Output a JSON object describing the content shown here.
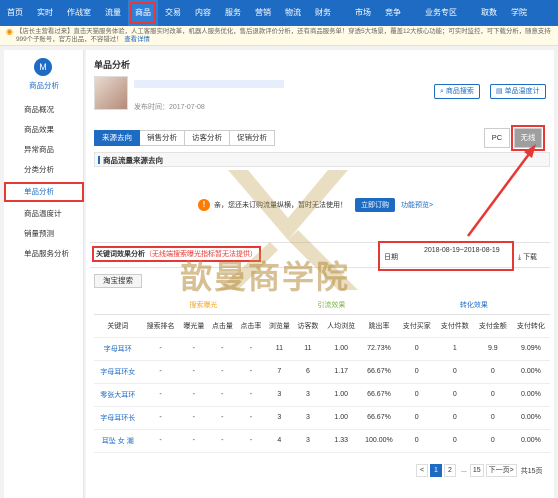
{
  "topnav": {
    "items": [
      "首页",
      "实时",
      "作战室",
      "流量",
      "商品",
      "交易",
      "内容",
      "服务",
      "营销",
      "物流",
      "财务",
      "市场",
      "竞争",
      "业务专区",
      "取数",
      "学院"
    ]
  },
  "notice": {
    "text": "【店长主营看过来】直击天猫服务体验，人工客服实时改革，机器人服务优化，售后退款评价分析，还有商品服务单！穿透5大场景，覆盖12大核心功能；可实时监控，可下载分析，随意支持999个子账号，官方出品，不容错过！",
    "link": "查看详情"
  },
  "sidebar": {
    "title": "商品分析",
    "items": [
      "商品概况",
      "商品效果",
      "异常商品",
      "分类分析",
      "单品分析",
      "商品温度计",
      "销量预测",
      "单品服务分析"
    ]
  },
  "main": {
    "title": "单品分析",
    "publish": "发布时间：2017-07-08",
    "btn_search": "商品搜索",
    "btn_temp": "单品温度计",
    "tabs": [
      "来源去向",
      "销售分析",
      "访客分析",
      "促销分析"
    ],
    "toggle_pc": "PC",
    "toggle_wireless": "无线",
    "section_title": "商品流量来源去向",
    "warn_text": "亲，您还未订购流量纵横，暂时无法使用！",
    "warn_btn": "立即订购",
    "warn_link": "功能预览>",
    "kw_title": "关键词效果分析",
    "kw_note": "（无线端搜索曝光指标暂无法提供）",
    "date_label": "日期",
    "date_range": "2018-08-19~2018-08-19",
    "download": "下载",
    "search_tab": "淘宝搜索"
  },
  "table": {
    "groups": [
      "搜索曝光",
      "引流效果",
      "转化效果"
    ],
    "headers": [
      "关键词",
      "搜索排名",
      "曝光量",
      "点击量",
      "点击率",
      "浏览量",
      "访客数",
      "人均浏览",
      "跳出率",
      "支付买家",
      "支付件数",
      "支付金额",
      "支付转化"
    ],
    "rows": [
      [
        "字母耳环",
        "-",
        "-",
        "-",
        "-",
        "11",
        "11",
        "1.00",
        "72.73%",
        "0",
        "1",
        "9.9",
        "9.09%"
      ],
      [
        "字母耳环女",
        "-",
        "-",
        "-",
        "-",
        "7",
        "6",
        "1.17",
        "66.67%",
        "0",
        "0",
        "0",
        "0.00%"
      ],
      [
        "零张大耳环",
        "-",
        "-",
        "-",
        "-",
        "3",
        "3",
        "1.00",
        "66.67%",
        "0",
        "0",
        "0",
        "0.00%"
      ],
      [
        "字母耳环长",
        "-",
        "-",
        "-",
        "-",
        "3",
        "3",
        "1.00",
        "66.67%",
        "0",
        "0",
        "0",
        "0.00%"
      ],
      [
        "耳坠 女 潮",
        "-",
        "-",
        "-",
        "-",
        "4",
        "3",
        "1.33",
        "100.00%",
        "0",
        "0",
        "0",
        "0.00%"
      ]
    ]
  },
  "pager": {
    "prev": "<",
    "pages": [
      "1",
      "2"
    ],
    "ellipsis": "...",
    "last": "15",
    "next": "下一页>",
    "total": "共15页"
  },
  "watermark": "歆曼商学院"
}
